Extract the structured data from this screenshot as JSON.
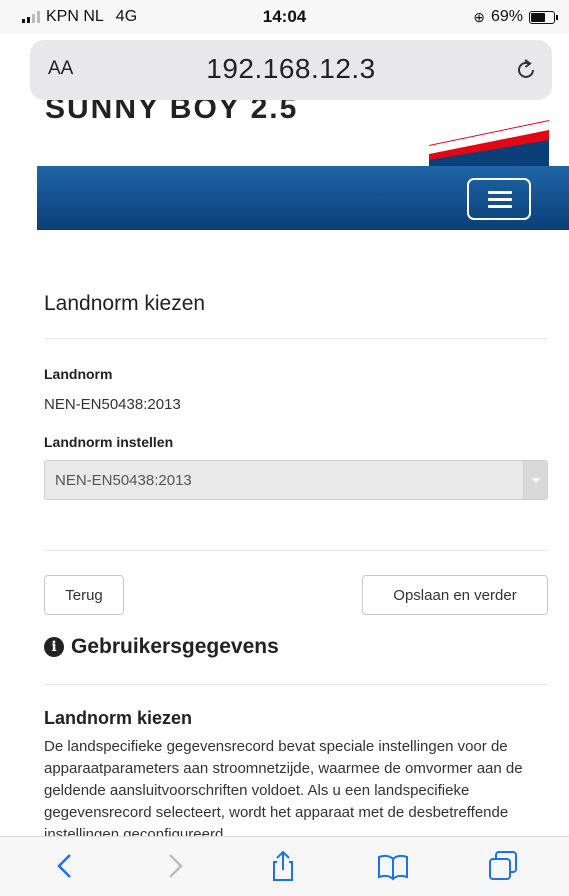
{
  "status": {
    "carrier": "KPN NL",
    "network": "4G",
    "time": "14:04",
    "battery": "69%"
  },
  "browser": {
    "text_size_label": "AA",
    "url": "192.168.12.3"
  },
  "site": {
    "brand_name": "SUNNY BOY 2.5",
    "accent_color": "#1f65a6",
    "logo_color": "#e30613"
  },
  "form": {
    "title": "Landnorm kiezen",
    "current_label": "Landnorm",
    "current_value": "NEN-EN50438:2013",
    "set_label": "Landnorm instellen",
    "set_value": "NEN-EN50438:2013",
    "back_label": "Terug",
    "save_label": "Opslaan en verder"
  },
  "help": {
    "heading": "Gebruikersgegevens",
    "title": "Landnorm kiezen",
    "text": "De landspecifieke gegevensrecord bevat speciale instellingen voor de apparaatparameters aan stroomnetzijde, waarmee de omvormer aan de geldende aansluitvoorschriften voldoet. Als u een landspecifieke gegevensrecord selecteert, wordt het apparaat met de desbetreffende instellingen geconfigureerd."
  },
  "toolbar": {
    "icons": [
      "back-icon",
      "forward-icon",
      "share-icon",
      "bookmarks-icon",
      "tabs-icon"
    ]
  }
}
